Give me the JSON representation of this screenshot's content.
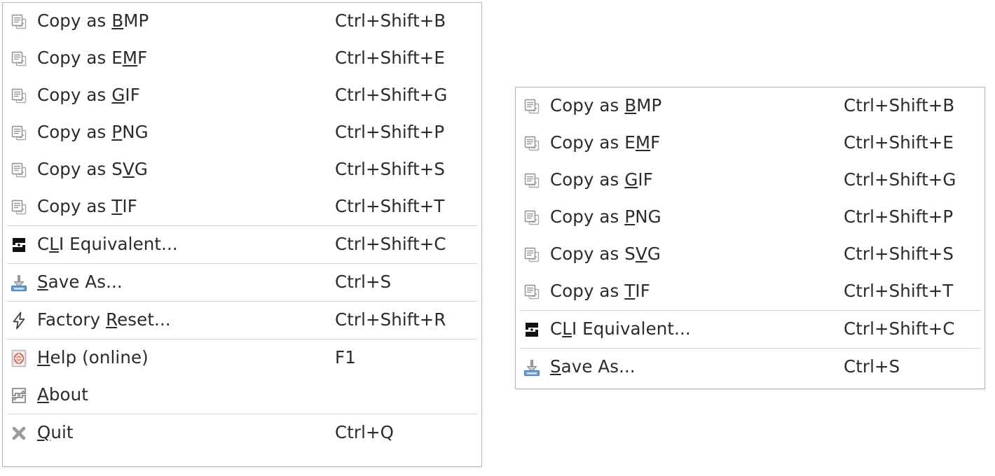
{
  "app": {
    "kind": "context-menu",
    "colors": {
      "panel_bg": "#ffffff",
      "panel_border": "#b7b7b7",
      "text": "#2b2b2b",
      "separator": "#d4d4d4",
      "icon_blue": "#6f9fd0",
      "icon_grey": "#9a9a9a",
      "icon_black": "#1a1a1a",
      "icon_lifebuoy": "#cf7a5e"
    }
  },
  "menus": [
    {
      "id": "menu-left",
      "name": "full-context-menu",
      "items": [
        {
          "type": "item",
          "icon": "copy-icon",
          "label_pre": "Copy as ",
          "label_mnemonic": "B",
          "label_post": "MP",
          "accel": "Ctrl+Shift+B"
        },
        {
          "type": "item",
          "icon": "copy-icon",
          "label_pre": "Copy as E",
          "label_mnemonic": "M",
          "label_post": "F",
          "accel": "Ctrl+Shift+E"
        },
        {
          "type": "item",
          "icon": "copy-icon",
          "label_pre": "Copy as ",
          "label_mnemonic": "G",
          "label_post": "IF",
          "accel": "Ctrl+Shift+G"
        },
        {
          "type": "item",
          "icon": "copy-icon",
          "label_pre": "Copy as ",
          "label_mnemonic": "P",
          "label_post": "NG",
          "accel": "Ctrl+Shift+P"
        },
        {
          "type": "item",
          "icon": "copy-icon",
          "label_pre": "Copy as S",
          "label_mnemonic": "V",
          "label_post": "G",
          "accel": "Ctrl+Shift+S"
        },
        {
          "type": "item",
          "icon": "copy-icon",
          "label_pre": "Copy as ",
          "label_mnemonic": "T",
          "label_post": "IF",
          "accel": "Ctrl+Shift+T"
        },
        {
          "type": "separator"
        },
        {
          "type": "item",
          "icon": "cli-equivalent-icon",
          "label_pre": "C",
          "label_mnemonic": "L",
          "label_post": "I Equivalent...",
          "accel": "Ctrl+Shift+C"
        },
        {
          "type": "separator"
        },
        {
          "type": "item",
          "icon": "save-as-icon",
          "label_pre": "",
          "label_mnemonic": "S",
          "label_post": "ave As...",
          "accel": "Ctrl+S"
        },
        {
          "type": "separator"
        },
        {
          "type": "item",
          "icon": "factory-reset-icon",
          "label_pre": "Factory ",
          "label_mnemonic": "R",
          "label_post": "eset...",
          "accel": "Ctrl+Shift+R"
        },
        {
          "type": "separator"
        },
        {
          "type": "item",
          "icon": "help-icon",
          "label_pre": "",
          "label_mnemonic": "H",
          "label_post": "elp (online)",
          "accel": "F1"
        },
        {
          "type": "item",
          "icon": "about-icon",
          "label_pre": "",
          "label_mnemonic": "A",
          "label_post": "bout",
          "accel": ""
        },
        {
          "type": "separator"
        },
        {
          "type": "item",
          "icon": "quit-icon",
          "label_pre": "",
          "label_mnemonic": "Q",
          "label_post": "uit",
          "accel": "Ctrl+Q"
        }
      ]
    },
    {
      "id": "menu-right",
      "name": "reduced-context-menu",
      "items": [
        {
          "type": "item",
          "icon": "copy-icon",
          "label_pre": "Copy as ",
          "label_mnemonic": "B",
          "label_post": "MP",
          "accel": "Ctrl+Shift+B"
        },
        {
          "type": "item",
          "icon": "copy-icon",
          "label_pre": "Copy as E",
          "label_mnemonic": "M",
          "label_post": "F",
          "accel": "Ctrl+Shift+E"
        },
        {
          "type": "item",
          "icon": "copy-icon",
          "label_pre": "Copy as ",
          "label_mnemonic": "G",
          "label_post": "IF",
          "accel": "Ctrl+Shift+G"
        },
        {
          "type": "item",
          "icon": "copy-icon",
          "label_pre": "Copy as ",
          "label_mnemonic": "P",
          "label_post": "NG",
          "accel": "Ctrl+Shift+P"
        },
        {
          "type": "item",
          "icon": "copy-icon",
          "label_pre": "Copy as S",
          "label_mnemonic": "V",
          "label_post": "G",
          "accel": "Ctrl+Shift+S"
        },
        {
          "type": "item",
          "icon": "copy-icon",
          "label_pre": "Copy as ",
          "label_mnemonic": "T",
          "label_post": "IF",
          "accel": "Ctrl+Shift+T"
        },
        {
          "type": "separator"
        },
        {
          "type": "item",
          "icon": "cli-equivalent-icon",
          "label_pre": "C",
          "label_mnemonic": "L",
          "label_post": "I Equivalent...",
          "accel": "Ctrl+Shift+C"
        },
        {
          "type": "separator"
        },
        {
          "type": "item",
          "icon": "save-as-icon",
          "label_pre": "",
          "label_mnemonic": "S",
          "label_post": "ave As...",
          "accel": "Ctrl+S"
        }
      ]
    }
  ]
}
